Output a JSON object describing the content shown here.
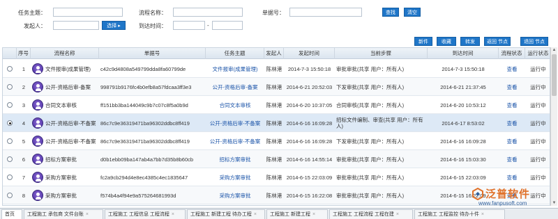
{
  "search": {
    "task_subject_label": "任务主题：",
    "process_name_label": "流程名称：",
    "doc_no_label": "单据号：",
    "initiator_label": "发起人：",
    "select_button": "选择 ▸",
    "arrival_time_label": "到达时间：",
    "date_dash": "-",
    "search_button": "查找",
    "clear_button": "清空"
  },
  "toolbar": {
    "buttons": [
      "新件",
      "收藏",
      "转发",
      "返回 节点",
      "退回 节点"
    ]
  },
  "table": {
    "columns": [
      "序号",
      "流程名称",
      "单据号",
      "任务主题",
      "发起人",
      "发起时间",
      "当前步骤",
      "到达时间",
      "流程状态",
      "运行状态"
    ],
    "rows": [
      {
        "no": "1",
        "process": "文件报审(成果管理)",
        "doc": "c42c9d4808a549799dda8fa60799de",
        "task": "文件报审(成果管理)",
        "initiator": "陈林港",
        "start": "2014-7-3 15:50:18",
        "step": "审批审批(共享 用户：所有人)",
        "arrive": "2014-7-3 15:50:18",
        "status": "查看",
        "run": "运行中"
      },
      {
        "no": "2",
        "process": "公开-资格后审-备案",
        "doc": "998791b9176fc4b0efb8a57fdcaa3ff3e3",
        "task": "公开-资格后审-备案",
        "initiator": "陈林港",
        "start": "2014-6-21 20:52:03",
        "step": "下发审批(共享 用户：所有人)",
        "arrive": "2014-6-21 21:37:45",
        "status": "查看",
        "run": "运行中"
      },
      {
        "no": "3",
        "process": "合同文本审核",
        "doc": "ff151bb3ba144049c9b7c07c8f5a0b9d",
        "task": "合同文本审核",
        "initiator": "陈林港",
        "start": "2014-6-20 10:37:05",
        "step": "合同审核(共享 用户：所有人)",
        "arrive": "2014-6-20 10:53:12",
        "status": "查看",
        "run": "运行中"
      },
      {
        "no": "4",
        "process": "公开-资格后审-不备案",
        "doc": "86c7c9e36319471ba96302ddbc8ff419",
        "task": "公开-资格后审-不备案",
        "initiator": "陈林港",
        "start": "2014-6-16 16:09:28",
        "step": "招标文件编制、审查(共享 用户：所有人)",
        "arrive": "2014-6-17 8:53:02",
        "status": "查看",
        "run": "运行中"
      },
      {
        "no": "5",
        "process": "公开-资格后审-不备案",
        "doc": "86c7c9e36319471ba96302ddbc8ff419",
        "task": "公开-资格后审-不备案",
        "initiator": "陈林港",
        "start": "2014-6-16 16:09:28",
        "step": "下发审批(共享 用户：所有人)",
        "arrive": "2014-6-16 16:09:28",
        "status": "查看",
        "run": "运行中"
      },
      {
        "no": "6",
        "process": "招标方案审批",
        "doc": "d0b1ebb09ba147ab4a7bb7d35b8b60cb",
        "task": "招标方案审批",
        "initiator": "陈林港",
        "start": "2014-6-16 14:55:14",
        "step": "审批审批(共享 用户：所有人)",
        "arrive": "2014-6-16 15:03:30",
        "status": "查看",
        "run": "运行中"
      },
      {
        "no": "7",
        "process": "采购方案审批",
        "doc": "fc2a9cb294d4e8ec4385c4ec1835647",
        "task": "采购方案审批",
        "initiator": "陈林港",
        "start": "2014-6-15 22:03:09",
        "step": "审批审批(共享 用户：所有人)",
        "arrive": "2014-6-15 22:03:09",
        "status": "查看",
        "run": "运行中"
      },
      {
        "no": "8",
        "process": "采购方案审批",
        "doc": "f574b4a4f94e9a575264681993d",
        "task": "采购方案审批",
        "initiator": "陈林港",
        "start": "2014-6-15 16:22:08",
        "step": "审批审批(共享 用户：所有人)",
        "arrive": "2014-6-15 16:22:09",
        "status": "查看",
        "run": "运行中"
      }
    ],
    "selected_row": 4
  },
  "tabs": [
    {
      "label": "首页",
      "close": ""
    },
    {
      "label": "工程施工 承包商 文件台账",
      "close": "×"
    },
    {
      "label": "工程施工 工程信息 工程流程",
      "close": "×"
    },
    {
      "label": "工程施工 新建工程 待办工程",
      "close": "×"
    },
    {
      "label": "工程施工 新建工程",
      "close": "×"
    },
    {
      "label": "工程施工 工程流程 工程在建",
      "close": "×"
    },
    {
      "label": "工程施工 工程监控 待办十件",
      "close": "×"
    }
  ],
  "watermark": {
    "brand": "泛普软件",
    "url": "www.fanpusoft.com"
  },
  "colors": {
    "accent": "#1f76c8",
    "link": "#1a53a8",
    "brand": "#e0712a"
  }
}
